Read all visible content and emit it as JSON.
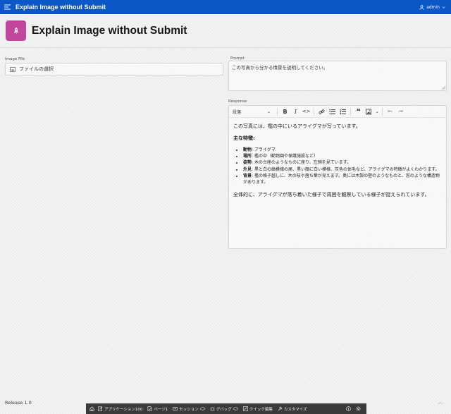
{
  "header": {
    "app_title": "Explain Image without Submit",
    "user": "admin"
  },
  "page": {
    "title": "Explain Image without Submit",
    "icon": "rocket-icon"
  },
  "form": {
    "image_file": {
      "label": "Image File",
      "button_text": "ファイルの選択"
    },
    "prompt": {
      "label": "Prompt",
      "value": "この写真から分かる情景を説明してください。"
    },
    "response": {
      "label": "Response",
      "toolbar": {
        "format_select": "段落"
      },
      "content": {
        "intro": "この写真には、檻の中にいるアライグマが写っています。",
        "heading": "主な特徴:",
        "items": [
          {
            "label": "動物",
            "text": ": アライグマ"
          },
          {
            "label": "場所",
            "text": ": 檻の中（動物園や保護施設など）"
          },
          {
            "label": "姿勢",
            "text": ": 木の台座のようなものに座り、左側を見ています。"
          },
          {
            "label": "外見",
            "text": ": 黒と白の縞模様の尾、黒い顔に白い模様、灰色の体毛など、アライグマの特徴がよくわかります。"
          },
          {
            "label": "背景",
            "text": ": 檻の格子越しに、木の枝や落ち葉が見えます。奥には木製の壁のようなものと、窓のような構造物があります。"
          }
        ],
        "summary": "全体的に、アライグマが落ち着いた様子で周囲を観察している様子が捉えられています。"
      }
    }
  },
  "footer": {
    "release": "Release 1.0"
  },
  "dev_toolbar": {
    "app_label": "アプリケーション100",
    "page_label": "ページ1",
    "session_label": "セッション",
    "debug_label": "デバッグ",
    "quick_edit_label": "クイック編集",
    "customize_label": "カスタマイズ"
  },
  "colors": {
    "header_bg": "#0b57c6",
    "page_icon_bg": "#c1479e",
    "dev_toolbar_bg": "#3a3a3a"
  }
}
